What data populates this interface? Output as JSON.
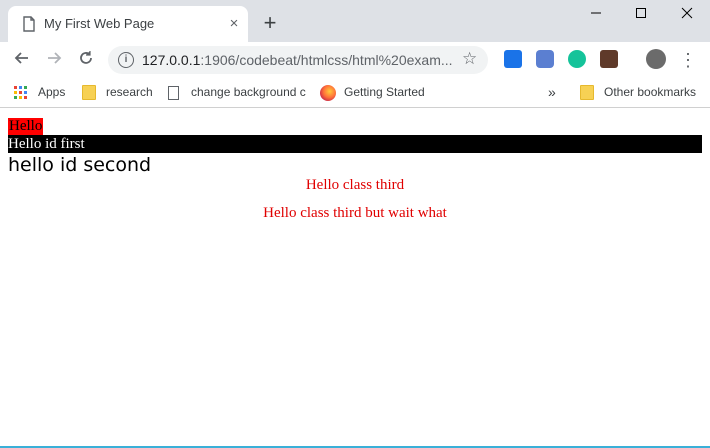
{
  "browser": {
    "tab_title": "My First Web Page",
    "tab_close": "×",
    "new_tab": "+",
    "url_host": "127.0.0.1",
    "url_rest": ":1906/codebeat/htmlcss/html%20exam...",
    "info_icon": "i",
    "window": {
      "minimize": "–",
      "maximize": "☐",
      "close": "✕"
    },
    "nav": {
      "back": "←",
      "forward": "→",
      "reload": "↻"
    },
    "star": "☆",
    "menu": "⋮"
  },
  "bookmarks": {
    "items": [
      "Apps",
      "research",
      "change background c",
      "Getting Started"
    ],
    "overflow": "»",
    "other": "Other bookmarks"
  },
  "page": {
    "hello": "Hello",
    "id_first": "Hello id first",
    "id_second": "hello id second",
    "class_third": "Hello class third",
    "class_third_wait": "Hello class third but wait what"
  },
  "colors": {
    "red": "#ff0000",
    "text_red": "#e00000",
    "black": "#000000",
    "accent": "#3ab0d8"
  }
}
